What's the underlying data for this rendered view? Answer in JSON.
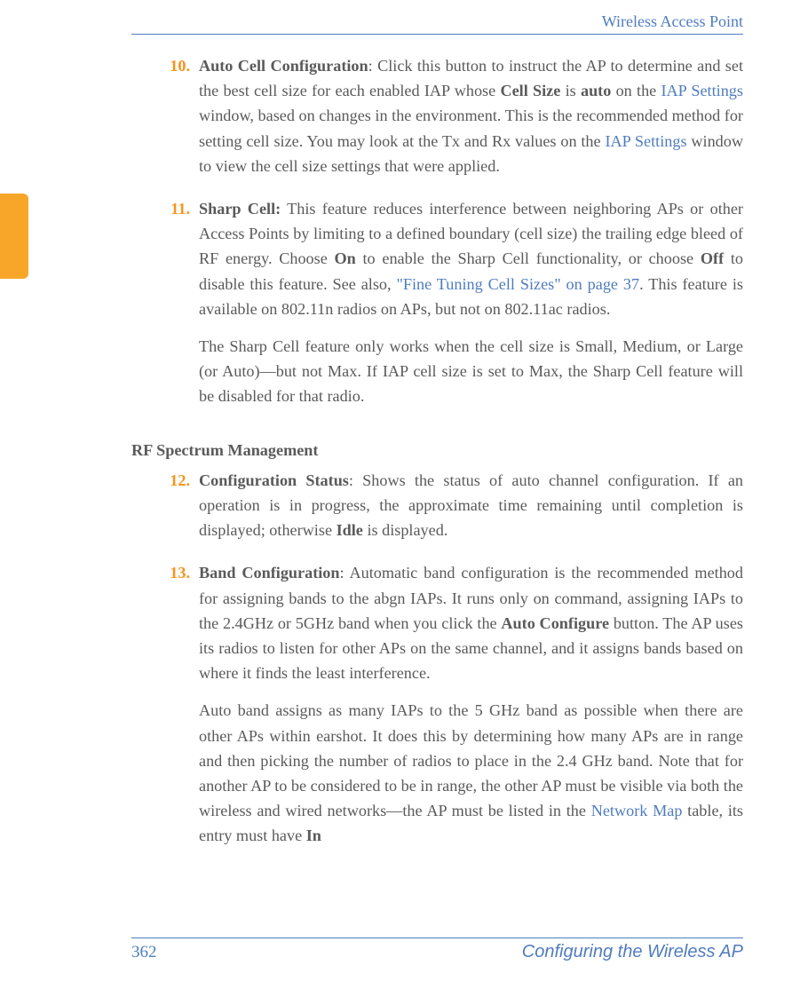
{
  "header": {
    "title": "Wireless Access Point"
  },
  "footer": {
    "page": "362",
    "section": "Configuring the Wireless AP"
  },
  "section_heading": "RF Spectrum Management",
  "items": {
    "i10": {
      "num": "10.",
      "lead": "Auto Cell Configuration",
      "t1a": ": Click this button to instruct the AP to determine and set the best cell size for each enabled IAP whose ",
      "t1b": "Cell Size",
      "t1c": " is ",
      "t1d": "auto",
      "t1e": " on the ",
      "link1": "IAP Settings",
      "t1f": " window, based on changes in the environment. This is the recommended method for setting cell size. You may look at the Tx and Rx values on the ",
      "link2": "IAP Settings",
      "t1g": " window to view the cell size settings that were applied."
    },
    "i11": {
      "num": "11.",
      "lead": "Sharp Cell:",
      "t1a": " This feature reduces interference between neighboring APs or other Access Points by limiting to a defined boundary (cell size) the trailing edge bleed of RF energy. Choose ",
      "t1b": "On",
      "t1c": " to enable the Sharp Cell functionality, or choose ",
      "t1d": "Off",
      "t1e": " to disable this feature. See also, ",
      "link1": "\"Fine Tuning Cell Sizes\" on page 37",
      "t1f": ". This feature is available on 802.11n radios on APs, but not on 802.11ac radios.",
      "p2": "The Sharp Cell feature only works when the cell size is Small, Medium, or Large (or Auto)—but not Max. If IAP cell size is set to Max, the Sharp Cell feature will be disabled for that radio."
    },
    "i12": {
      "num": "12.",
      "lead": "Configuration Status",
      "t1a": ": Shows the status of auto channel configuration. If an operation is in progress, the approximate time remaining until completion is displayed; otherwise ",
      "t1b": "Idle",
      "t1c": " is displayed."
    },
    "i13": {
      "num": "13.",
      "lead": "Band Configuration",
      "t1a": ": Automatic band configuration is the recommended method for assigning bands to the abgn IAPs. It runs only on command, assigning IAPs to the 2.4GHz or 5GHz band when you click the ",
      "t1b": "Auto Configure",
      "t1c": " button. The AP uses its radios to listen for other APs on the same channel, and it assigns bands based on where it finds the least interference.",
      "p2a": "Auto band assigns as many IAPs to the 5 GHz band as possible when there are other APs within earshot. It does this by determining how many APs are in range and then picking the number of radios to place in the 2.4 GHz band. Note that for another AP to be considered to be in range, the other AP must be visible via both the wireless and wired networks—the AP must be listed in the ",
      "link1": "Network Map",
      "p2b": " table, its entry must have ",
      "p2c": "In"
    }
  }
}
